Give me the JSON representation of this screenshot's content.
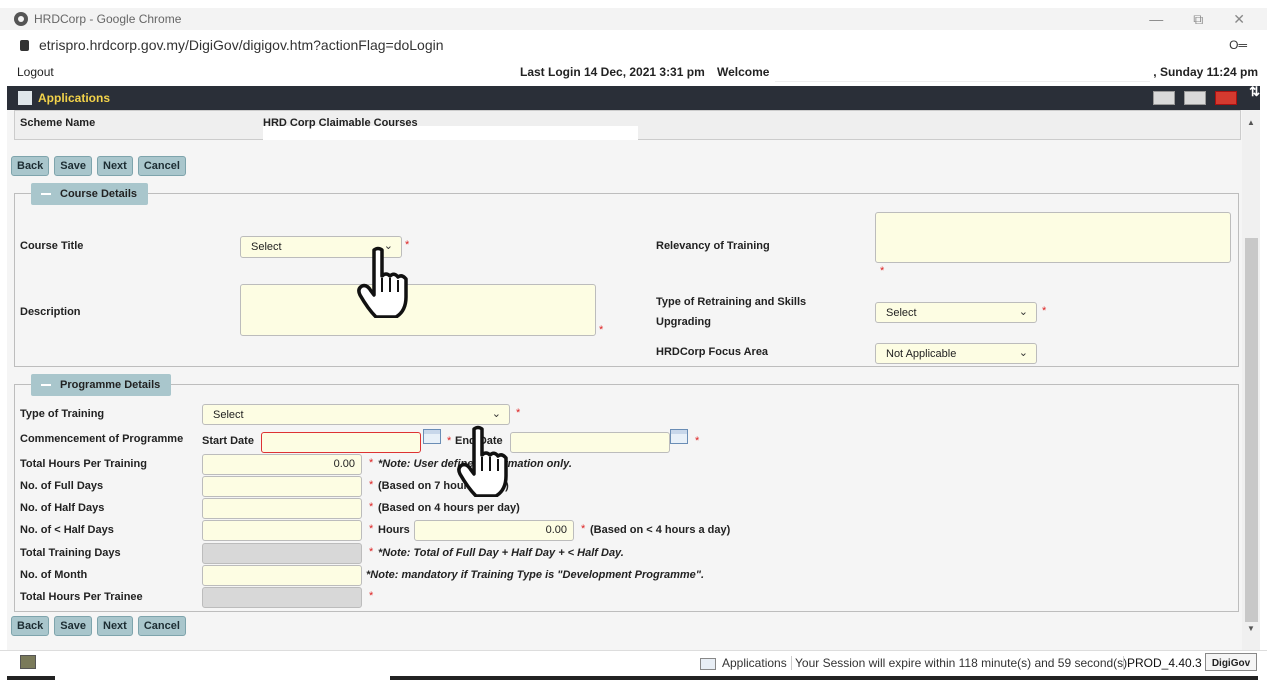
{
  "browser": {
    "title": "HRDCorp - Google Chrome",
    "url": "etrispro.hrdcorp.gov.my/DigiGov/digigov.htm?actionFlag=doLogin",
    "minimize": "—",
    "restore": "⧉",
    "close": "✕",
    "key_icon": "key-icon"
  },
  "topinfo": {
    "logout": "Logout",
    "last_login": "Last Login 14 Dec, 2021 3:31 pm",
    "welcome": "Welcome",
    "daytime": ", Sunday 11:24 pm"
  },
  "appbar": {
    "title": "Applications",
    "arrows": "⇅"
  },
  "scheme": {
    "label": "Scheme Name",
    "value": "HRD Corp Claimable Courses"
  },
  "buttons": {
    "back": "Back",
    "save": "Save",
    "next": "Next",
    "cancel": "Cancel"
  },
  "course": {
    "legend": "Course Details",
    "title_label": "Course Title",
    "title_value": "Select",
    "description_label": "Description",
    "relevancy_label": "Relevancy of Training",
    "retraining_label_1": "Type of Retraining and Skills",
    "retraining_label_2": "Upgrading",
    "retraining_value": "Select",
    "focus_label": "HRDCorp Focus Area",
    "focus_value": "Not Applicable"
  },
  "programme": {
    "legend": "Programme Details",
    "type_label": "Type of Training",
    "type_value": "Select",
    "commencement_label": "Commencement of Programme",
    "start_date_label": "Start Date",
    "end_date_label": "End Date",
    "total_hours_label": "Total Hours Per Training",
    "total_hours_value": "0.00",
    "total_hours_note": "*Note: User defined information only.",
    "full_days_label": "No. of Full Days",
    "full_days_note": "(Based on 7 hours a day)",
    "half_days_label": "No. of Half Days",
    "half_days_note": "(Based on 4 hours per day)",
    "lt_half_days_label": "No. of < Half Days",
    "hours_label": "Hours",
    "hours_value": "0.00",
    "hours_note": "(Based on < 4 hours a day)",
    "total_days_label": "Total Training Days",
    "total_days_note": "*Note: Total of Full Day + Half Day + < Half Day.",
    "months_label": "No. of Month",
    "months_note": "*Note: mandatory if Training Type is \"Development Programme\".",
    "trainee_hours_label": "Total Hours Per Trainee"
  },
  "status": {
    "applications": "Applications",
    "session": "Your Session will expire within 118 minute(s) and 59 second(s).",
    "prod": "PROD_4.40.3",
    "logo": "DigiGov"
  },
  "req_mark": "*",
  "chevron": "⌄"
}
